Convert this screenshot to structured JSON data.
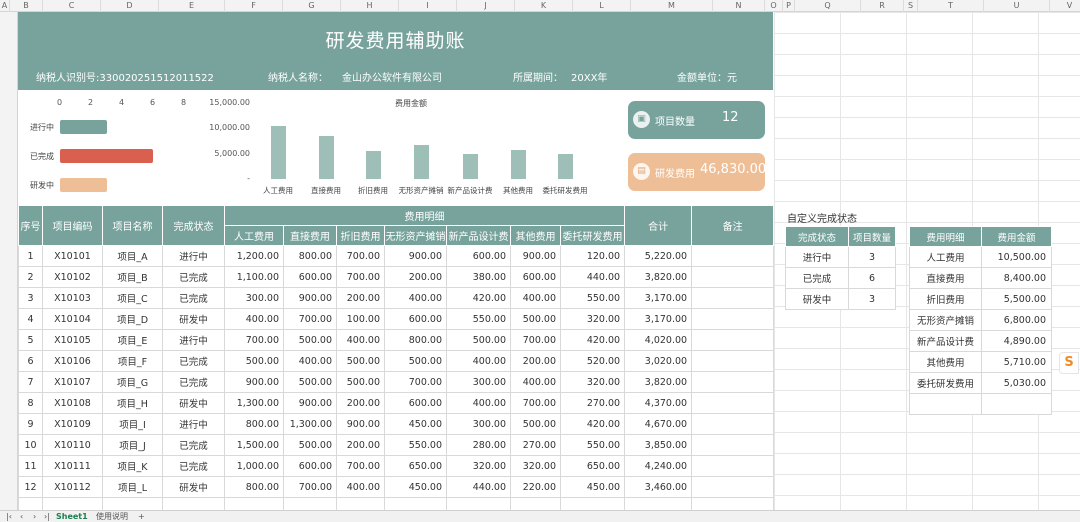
{
  "columns": [
    "A",
    "B",
    "C",
    "D",
    "E",
    "F",
    "G",
    "H",
    "I",
    "J",
    "K",
    "L",
    "M",
    "N",
    "O",
    "P",
    "Q",
    "R",
    "S",
    "T",
    "U",
    "V"
  ],
  "banner": {
    "title": "研发费用辅助账",
    "taxpayer_id": "纳税人识别号:330020251512011522",
    "taxpayer_name_label": "纳税人名称：",
    "taxpayer_name": "金山办公软件有限公司",
    "period_label": "所属期间：",
    "period": "20XX年",
    "unit": "金额单位：元"
  },
  "status_chart": {
    "ticks": [
      "0",
      "2",
      "4",
      "6",
      "8"
    ],
    "bars": [
      {
        "label": "进行中",
        "value": 3,
        "color": "#78a39d"
      },
      {
        "label": "已完成",
        "value": 6,
        "color": "#d9604e"
      },
      {
        "label": "研发中",
        "value": 3,
        "color": "#eebf97"
      }
    ]
  },
  "chart_data": {
    "type": "bar",
    "title": "费用金额",
    "categories": [
      "人工费用",
      "直接费用",
      "折旧费用",
      "无形资产摊销",
      "新产品设计费",
      "其他费用",
      "委托研发费用"
    ],
    "values": [
      10500,
      8400,
      5500,
      6800,
      4890,
      5710,
      5030
    ],
    "ylim": [
      0,
      15000
    ],
    "yticks": [
      "15,000.00",
      "10,000.00",
      "5,000.00",
      "-"
    ],
    "color": "#9dbfb7"
  },
  "kpis": [
    {
      "label": "项目数量",
      "value": "12",
      "color": "#78a39d",
      "icon": "briefcase-icon"
    },
    {
      "label": "研发费用",
      "value": "46,830.00",
      "color": "#eebf97",
      "icon": "document-icon"
    }
  ],
  "table": {
    "headers": {
      "seq": "序号",
      "code": "项目编码",
      "name": "项目名称",
      "status": "完成状态",
      "detail": "费用明细",
      "total": "合计",
      "remark": "备注",
      "sub": [
        "人工费用",
        "直接费用",
        "折旧费用",
        "无形资产摊销",
        "新产品设计费",
        "其他费用",
        "委托研发费用"
      ]
    },
    "rows": [
      [
        "1",
        "X10101",
        "项目_A",
        "进行中",
        "1,200.00",
        "800.00",
        "700.00",
        "900.00",
        "600.00",
        "900.00",
        "120.00",
        "5,220.00"
      ],
      [
        "2",
        "X10102",
        "项目_B",
        "已完成",
        "1,100.00",
        "600.00",
        "700.00",
        "200.00",
        "380.00",
        "600.00",
        "440.00",
        "3,820.00"
      ],
      [
        "3",
        "X10103",
        "项目_C",
        "已完成",
        "300.00",
        "900.00",
        "200.00",
        "400.00",
        "420.00",
        "400.00",
        "550.00",
        "3,170.00"
      ],
      [
        "4",
        "X10104",
        "项目_D",
        "研发中",
        "400.00",
        "700.00",
        "100.00",
        "600.00",
        "550.00",
        "500.00",
        "320.00",
        "3,170.00"
      ],
      [
        "5",
        "X10105",
        "项目_E",
        "进行中",
        "700.00",
        "500.00",
        "400.00",
        "800.00",
        "500.00",
        "700.00",
        "420.00",
        "4,020.00"
      ],
      [
        "6",
        "X10106",
        "项目_F",
        "已完成",
        "500.00",
        "400.00",
        "500.00",
        "500.00",
        "400.00",
        "200.00",
        "520.00",
        "3,020.00"
      ],
      [
        "7",
        "X10107",
        "项目_G",
        "已完成",
        "900.00",
        "500.00",
        "500.00",
        "700.00",
        "300.00",
        "400.00",
        "320.00",
        "3,820.00"
      ],
      [
        "8",
        "X10108",
        "项目_H",
        "研发中",
        "1,300.00",
        "900.00",
        "200.00",
        "600.00",
        "400.00",
        "700.00",
        "270.00",
        "4,370.00"
      ],
      [
        "9",
        "X10109",
        "项目_I",
        "进行中",
        "800.00",
        "1,300.00",
        "900.00",
        "450.00",
        "300.00",
        "500.00",
        "420.00",
        "4,670.00"
      ],
      [
        "10",
        "X10110",
        "项目_J",
        "已完成",
        "1,500.00",
        "500.00",
        "200.00",
        "550.00",
        "280.00",
        "270.00",
        "550.00",
        "3,850.00"
      ],
      [
        "11",
        "X10111",
        "项目_K",
        "已完成",
        "1,000.00",
        "600.00",
        "700.00",
        "650.00",
        "320.00",
        "320.00",
        "650.00",
        "4,240.00"
      ],
      [
        "12",
        "X10112",
        "项目_L",
        "研发中",
        "800.00",
        "700.00",
        "400.00",
        "450.00",
        "440.00",
        "220.00",
        "450.00",
        "3,460.00"
      ]
    ]
  },
  "status_summary": {
    "title": "自定义完成状态",
    "headers": [
      "完成状态",
      "项目数量"
    ],
    "rows": [
      [
        "进行中",
        "3"
      ],
      [
        "已完成",
        "6"
      ],
      [
        "研发中",
        "3"
      ]
    ]
  },
  "expense_summary": {
    "headers": [
      "费用明细",
      "费用金额"
    ],
    "rows": [
      [
        "人工费用",
        "10,500.00"
      ],
      [
        "直接费用",
        "8,400.00"
      ],
      [
        "折旧费用",
        "5,500.00"
      ],
      [
        "无形资产摊销",
        "6,800.00"
      ],
      [
        "新产品设计费",
        "4,890.00"
      ],
      [
        "其他费用",
        "5,710.00"
      ],
      [
        "委托研发费用",
        "5,030.00"
      ]
    ]
  },
  "tabs": {
    "sheet1": "Sheet1",
    "sheet2": "使用说明",
    "add": "+"
  }
}
